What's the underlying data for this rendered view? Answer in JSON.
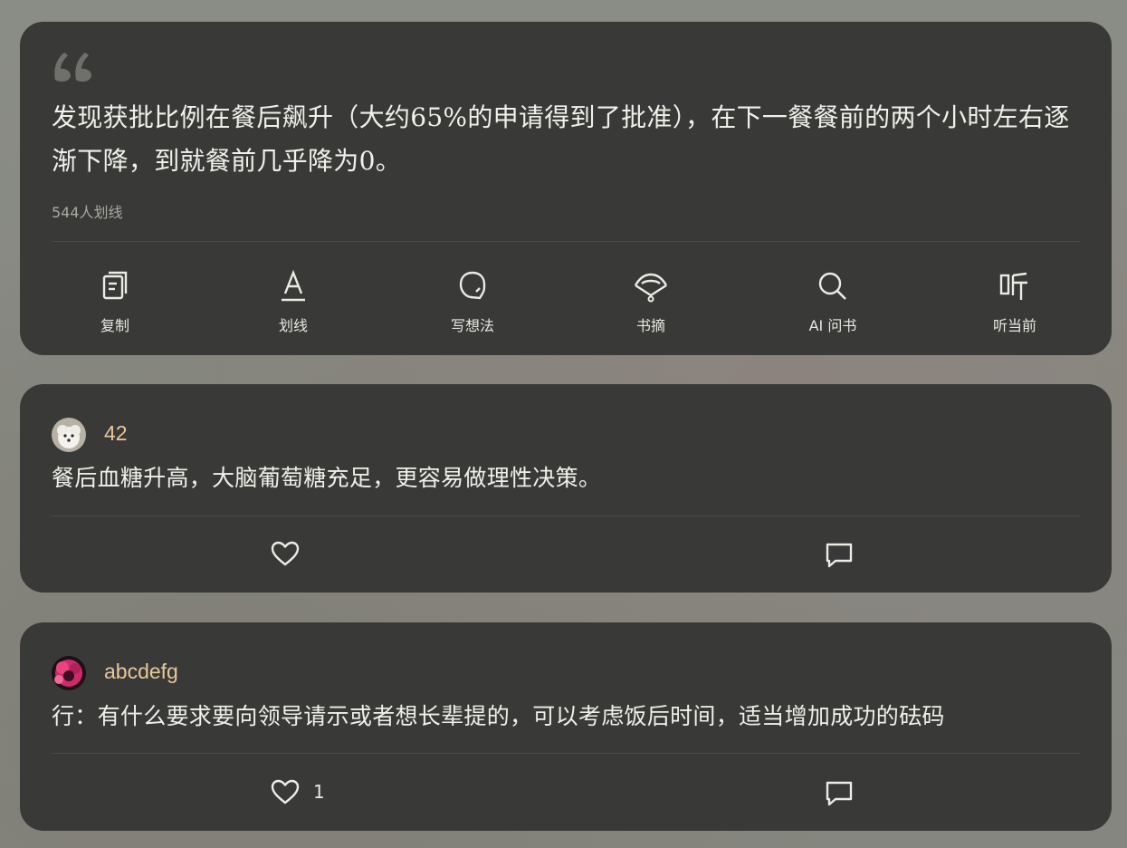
{
  "quote": {
    "text": "发现获批比例在餐后飙升（大约65%的申请得到了批准），在下一餐餐前的两个小时左右逐渐下降，到就餐前几乎降为0。",
    "highlight_count": "544人划线"
  },
  "actions": [
    {
      "label": "复制",
      "icon": "copy-icon"
    },
    {
      "label": "划线",
      "icon": "underline-icon"
    },
    {
      "label": "写想法",
      "icon": "thought-icon"
    },
    {
      "label": "书摘",
      "icon": "excerpt-icon"
    },
    {
      "label": "AI 问书",
      "icon": "search-icon"
    },
    {
      "label": "听当前",
      "icon": "listen-icon"
    }
  ],
  "comments": [
    {
      "username": "42",
      "text": "餐后血糖升高，大脑葡萄糖充足，更容易做理性决策。",
      "like_count": "",
      "avatar": "dog-avatar"
    },
    {
      "username": "abcdefg",
      "text": "行：有什么要求要向领导请示或者想长辈提的，可以考虑饭后时间，适当增加成功的砝码",
      "like_count": "1",
      "avatar": "flower-avatar"
    }
  ],
  "colors": {
    "card_bg": "#393a37",
    "username": "#e9c79a",
    "text": "#f0efea",
    "muted": "#a9a8a2"
  }
}
